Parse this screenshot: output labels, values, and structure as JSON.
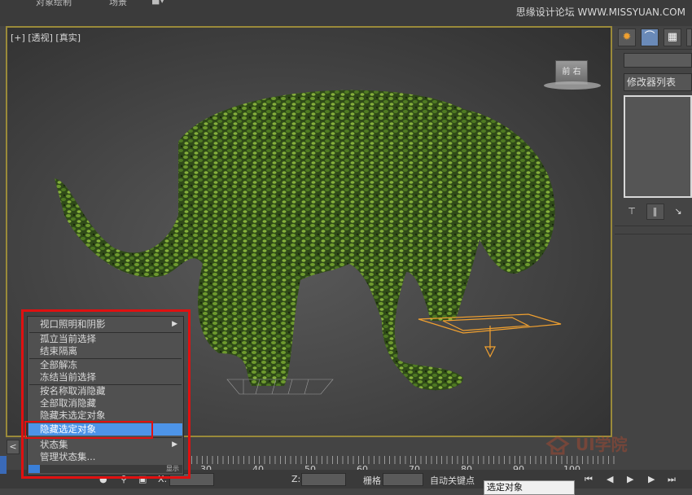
{
  "topbar": {
    "menus": [
      "对象绘制",
      "场景"
    ],
    "watermark": "思缘设计论坛 WWW.MISSYUAN.COM"
  },
  "viewport": {
    "labels": [
      "[+]",
      "[透视]",
      "[真实]"
    ],
    "viewcube_faces": "前 右"
  },
  "right_panel": {
    "tabs": [
      "sun-icon",
      "bend-icon",
      "hierarchy-icon"
    ],
    "modifier_list_label": "修改器列表",
    "tool_icons": [
      "pin-stack-icon",
      "show-end-result-icon",
      "make-unique-icon"
    ]
  },
  "context_menu": {
    "items": [
      {
        "label": "视口照明和阴影",
        "submenu": true,
        "selected": false
      },
      {
        "label": "孤立当前选择",
        "submenu": false,
        "selected": false
      },
      {
        "label": "结束隔离",
        "submenu": false,
        "selected": false
      },
      {
        "label": "全部解冻",
        "submenu": false,
        "selected": false
      },
      {
        "label": "冻结当前选择",
        "submenu": false,
        "selected": false
      },
      {
        "label": "按名称取消隐藏",
        "submenu": false,
        "selected": false
      },
      {
        "label": "全部取消隐藏",
        "submenu": false,
        "selected": false
      },
      {
        "label": "隐藏未选定对象",
        "submenu": false,
        "selected": false
      },
      {
        "label": "隐藏选定对象",
        "submenu": false,
        "selected": true
      },
      {
        "label": "状态集",
        "submenu": true,
        "selected": false
      },
      {
        "label": "管理状态集...",
        "submenu": false,
        "selected": false
      }
    ],
    "footer_text": "显示"
  },
  "timeline": {
    "ticks": [
      "30",
      "40",
      "50",
      "60",
      "70",
      "80",
      "90",
      "100"
    ],
    "left_button": "<"
  },
  "statusbar": {
    "x_label": "X:",
    "z_label": "Z:",
    "snap_label": "栅格",
    "autokey_label": "自动关键点",
    "selection_set": "选定对象"
  },
  "watermark_logo": "UI学院",
  "colors": {
    "selection_highlight": "#4d94e8",
    "annotation_red": "#e01010",
    "viewport_border": "#9a8a3a"
  }
}
